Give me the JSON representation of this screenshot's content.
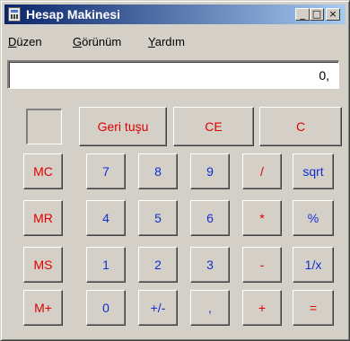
{
  "window": {
    "title": "Hesap Makinesi"
  },
  "title_buttons": {
    "minimize": "_",
    "maximize": "□",
    "close": "×"
  },
  "menu": {
    "edit": {
      "underline": "D",
      "rest": "üzen"
    },
    "view": {
      "underline": "G",
      "rest": "örünüm"
    },
    "help": {
      "underline": "Y",
      "rest": "ardım"
    }
  },
  "display": {
    "value": "0,"
  },
  "buttons": {
    "backspace": "Geri tuşu",
    "ce": "CE",
    "c": "C",
    "mc": "MC",
    "mr": "MR",
    "ms": "MS",
    "mplus": "M+",
    "d7": "7",
    "d8": "8",
    "d9": "9",
    "d4": "4",
    "d5": "5",
    "d6": "6",
    "d1": "1",
    "d2": "2",
    "d3": "3",
    "d0": "0",
    "sign": "+/-",
    "decimal": ",",
    "divide": "/",
    "multiply": "*",
    "subtract": "-",
    "add": "+",
    "sqrt": "sqrt",
    "percent": "%",
    "reciprocal": "1/x",
    "equals": "="
  },
  "colors": {
    "red": "#e00000",
    "blue": "#1030d0",
    "face": "#d4d0c8",
    "title_start": "#0a246a",
    "title_end": "#a6caf0"
  }
}
